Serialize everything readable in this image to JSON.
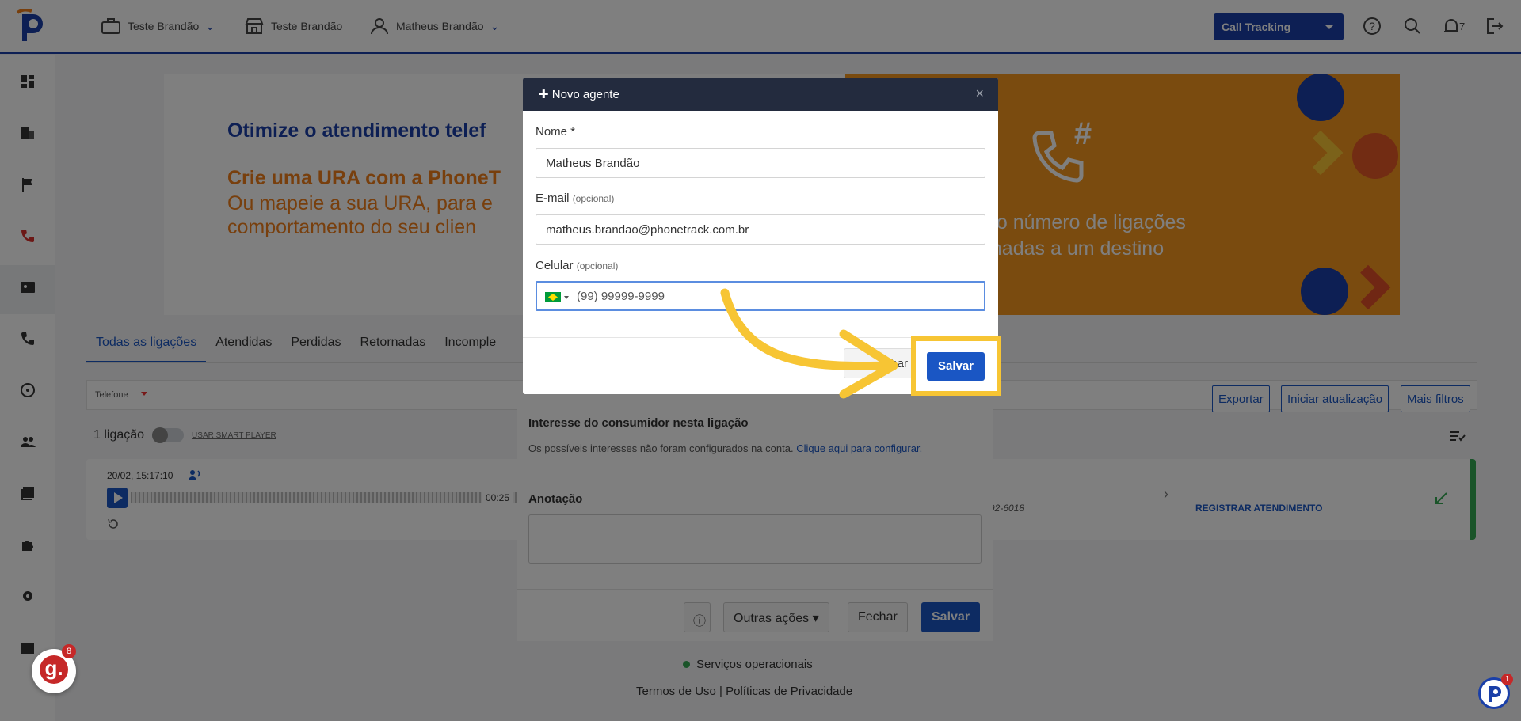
{
  "header": {
    "company_menu": "Teste Brandão",
    "store_label": "Teste Brandão",
    "user_menu": "Matheus Brandão",
    "product_select": "Call Tracking",
    "notifications_count": "7"
  },
  "banner": {
    "left_title": "Otimize o atendimento telef",
    "left_subtitle": "Crie uma URA com a PhoneT",
    "left_line1": "Ou mapeie a sua URA, para e",
    "left_line2": "comportamento do seu clien",
    "right_line1": "a o número de ligações",
    "right_line2": "onadas a um destino"
  },
  "tabs": [
    "Todas as ligações",
    "Atendidas",
    "Perdidas",
    "Retornadas",
    "Incomple"
  ],
  "filters": {
    "phone": "Telefone"
  },
  "actions": {
    "export": "Exportar",
    "start_update": "Iniciar atualização",
    "more_filters": "Mais filtros"
  },
  "calls": {
    "count": "1 ligação",
    "smart_player": "USAR SMART PLAYER",
    "item": {
      "date": "20/02, 15:17:10",
      "duration": "00:25",
      "phone_partial": "92-6018",
      "register": "REGISTRAR ATENDIMENTO"
    }
  },
  "call_panel": {
    "interest_title": "Interesse do consumidor nesta ligação",
    "interest_desc": "Os possíveis interesses não foram configurados na conta.",
    "interest_link": "Clique aqui para configurar.",
    "note_label": "Anotação",
    "other_actions": "Outras ações",
    "close": "Fechar",
    "save": "Salvar"
  },
  "modal": {
    "title": "Novo agente",
    "name_label": "Nome *",
    "name_value": "Matheus Brandão",
    "email_label": "E-mail",
    "email_optional": "(opcional)",
    "email_value": "matheus.brandao@phonetrack.com.br",
    "phone_label": "Celular",
    "phone_optional": "(opcional)",
    "phone_placeholder": "(99) 99999-9999",
    "close_label": "echar",
    "save_label": "Salvar"
  },
  "footer": {
    "status": "Serviços operacionais",
    "links": "Termos de Uso | Políticas de Privacidade"
  },
  "chat": {
    "g_label": "g.",
    "g_badge": "8",
    "p_badge": "1"
  },
  "colors": {
    "primary": "#1a56c4",
    "brand_dark": "#1a3fa8",
    "orange": "#f07f1a",
    "highlight": "#f7c534",
    "success": "#34a853"
  }
}
